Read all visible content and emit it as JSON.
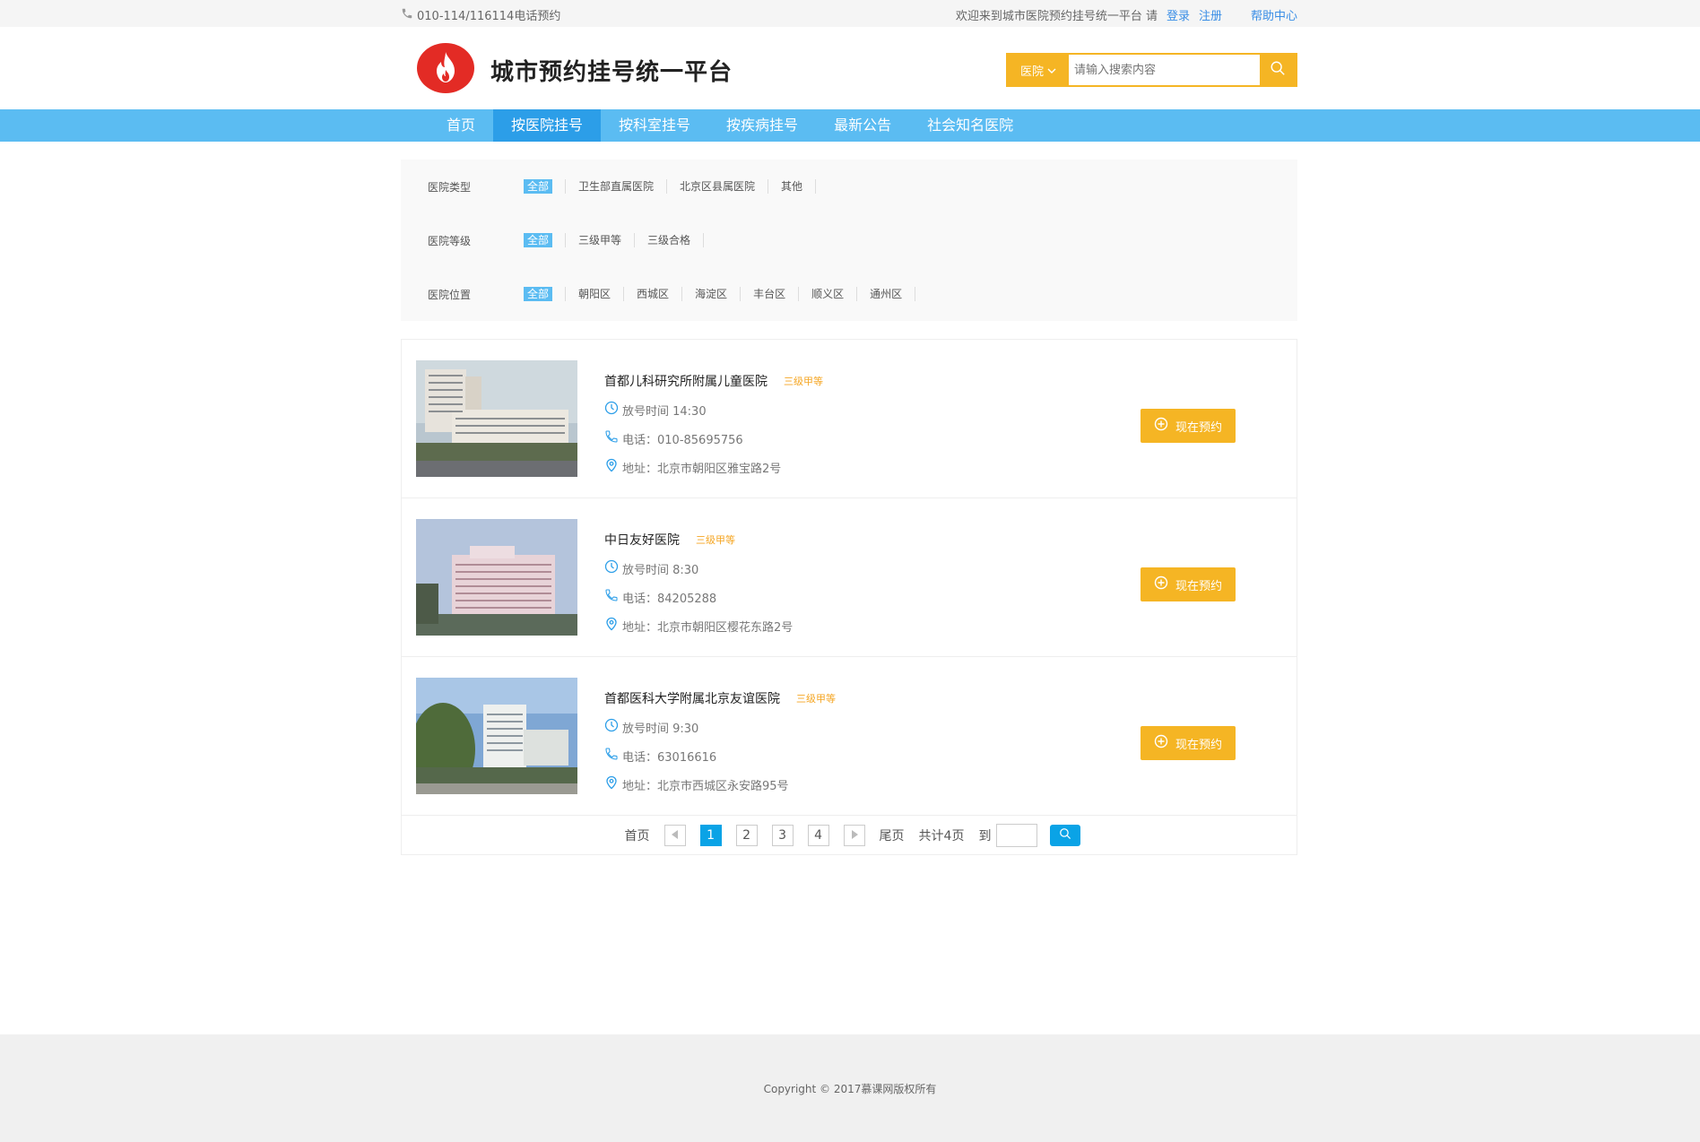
{
  "topbar": {
    "phone": "010-114/116114电话预约",
    "welcome": "欢迎来到城市医院预约挂号统一平台 请",
    "login": "登录",
    "register": "注册",
    "help": "帮助中心"
  },
  "header": {
    "title": "城市预约挂号统一平台",
    "search_type": "医院",
    "search_placeholder": "请输入搜索内容"
  },
  "nav": {
    "items": [
      "首页",
      "按医院挂号",
      "按科室挂号",
      "按疾病挂号",
      "最新公告",
      "社会知名医院"
    ],
    "active_index": 1
  },
  "filters": [
    {
      "label": "医院类型",
      "options": [
        "全部",
        "卫生部直属医院",
        "北京区县属医院",
        "其他"
      ]
    },
    {
      "label": "医院等级",
      "options": [
        "全部",
        "三级甲等",
        "三级合格"
      ]
    },
    {
      "label": "医院位置",
      "options": [
        "全部",
        "朝阳区",
        "西城区",
        "海淀区",
        "丰台区",
        "顺义区",
        "通州区"
      ]
    }
  ],
  "hospitals": [
    {
      "name": "首都儿科研究所附属儿童医院",
      "grade": "三级甲等",
      "time": "放号时间 14:30",
      "phone": "电话：010-85695756",
      "address": "地址：北京市朝阳区雅宝路2号"
    },
    {
      "name": "中日友好医院",
      "grade": "三级甲等",
      "time": "放号时间 8:30",
      "phone": "电话：84205288",
      "address": "地址：北京市朝阳区樱花东路2号"
    },
    {
      "name": "首都医科大学附属北京友谊医院",
      "grade": "三级甲等",
      "time": "放号时间 9:30",
      "phone": "电话：63016616",
      "address": "地址：北京市西城区永安路95号"
    }
  ],
  "book_label": "现在预约",
  "pager": {
    "first": "首页",
    "pages": [
      "1",
      "2",
      "3",
      "4"
    ],
    "current": "1",
    "last": "尾页",
    "total": "共计4页",
    "goto": "到"
  },
  "footer": {
    "copyright": "Copyright © 2017慕课网版权所有"
  },
  "colors": {
    "nav": "#5bbcf2",
    "nav_active": "#2c9ee8",
    "accent": "#f5b524",
    "pager": "#0aa3e6"
  }
}
